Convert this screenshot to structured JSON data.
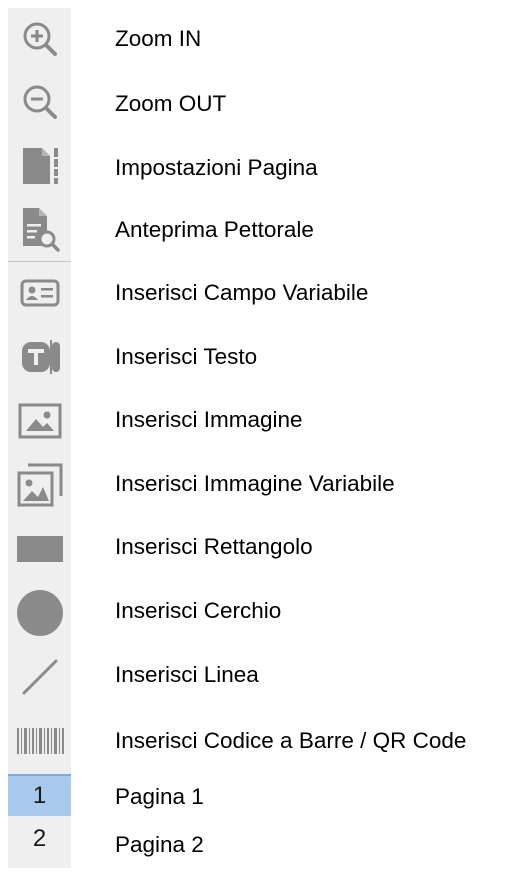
{
  "icon_color": "#8a8a8a",
  "selected_page_color": "#a6c9ec",
  "tools": [
    {
      "icon": "zoom-in-icon",
      "label": "Zoom IN"
    },
    {
      "icon": "zoom-out-icon",
      "label": "Zoom OUT"
    },
    {
      "icon": "page-settings-icon",
      "label": "Impostazioni Pagina"
    },
    {
      "icon": "bib-preview-icon",
      "label": "Anteprima Pettorale"
    },
    {
      "icon": "variable-field-icon",
      "label": "Inserisci Campo Variabile"
    },
    {
      "icon": "text-box-icon",
      "label": "Inserisci Testo"
    },
    {
      "icon": "image-icon",
      "label": "Inserisci Immagine"
    },
    {
      "icon": "variable-image-icon",
      "label": "Inserisci Immagine Variabile"
    },
    {
      "icon": "rectangle-icon",
      "label": "Inserisci Rettangolo"
    },
    {
      "icon": "circle-icon",
      "label": "Inserisci Cerchio"
    },
    {
      "icon": "line-icon",
      "label": "Inserisci Linea"
    },
    {
      "icon": "barcode-icon",
      "label": "Inserisci Codice a Barre / QR Code"
    }
  ],
  "pages": [
    {
      "number": "1",
      "label": "Pagina 1",
      "selected": true
    },
    {
      "number": "2",
      "label": "Pagina 2",
      "selected": false
    }
  ]
}
